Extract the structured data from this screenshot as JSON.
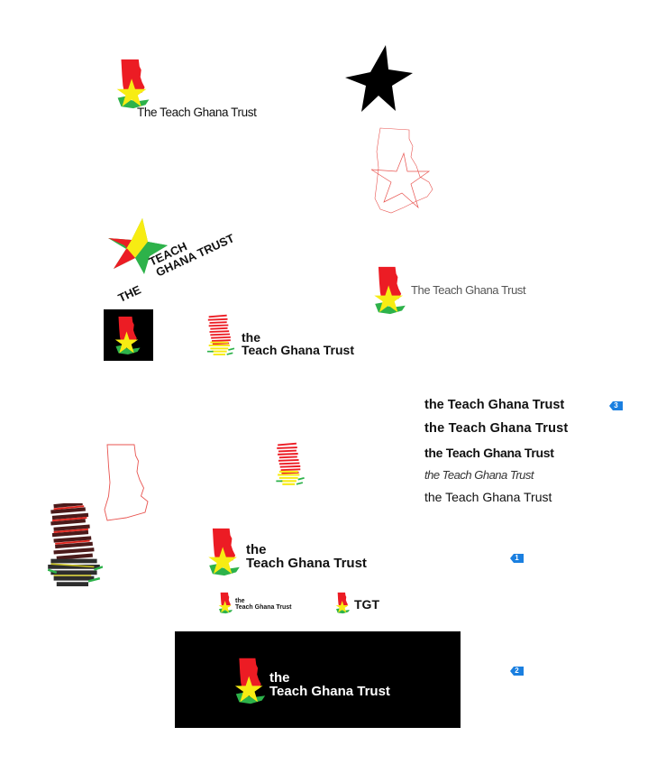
{
  "colors": {
    "red": "#ec1c24",
    "yellow": "#f7ec13",
    "green": "#2db24a",
    "black": "#000000",
    "outline": "#e8534f",
    "marker_blue": "#1a7fe0"
  },
  "wordmarks": {
    "logo_thin_1": "The Teach Ghana Trust",
    "logo_thin_2": "The Teach Ghana Trust",
    "diagonal_line1": "THE",
    "diagonal_line2": "TEACH",
    "diagonal_line3": "GHANA TRUST",
    "stacked_sketch_the": "the",
    "stacked_sketch_name": "Teach Ghana Trust",
    "stacked_main_the": "the",
    "stacked_main_name": "Teach Ghana Trust",
    "small_the": "the",
    "small_name": "Teach Ghana Trust",
    "abbrev": "TGT",
    "dark_the": "the",
    "dark_name": "Teach Ghana Trust"
  },
  "type_samples": [
    "the Teach Ghana Trust",
    "the Teach Ghana Trust",
    "the Teach Ghana Trust",
    "the Teach Ghana Trust",
    "the Teach Ghana Trust"
  ],
  "markers": {
    "m1": "1",
    "m2": "2",
    "m3": "3"
  }
}
